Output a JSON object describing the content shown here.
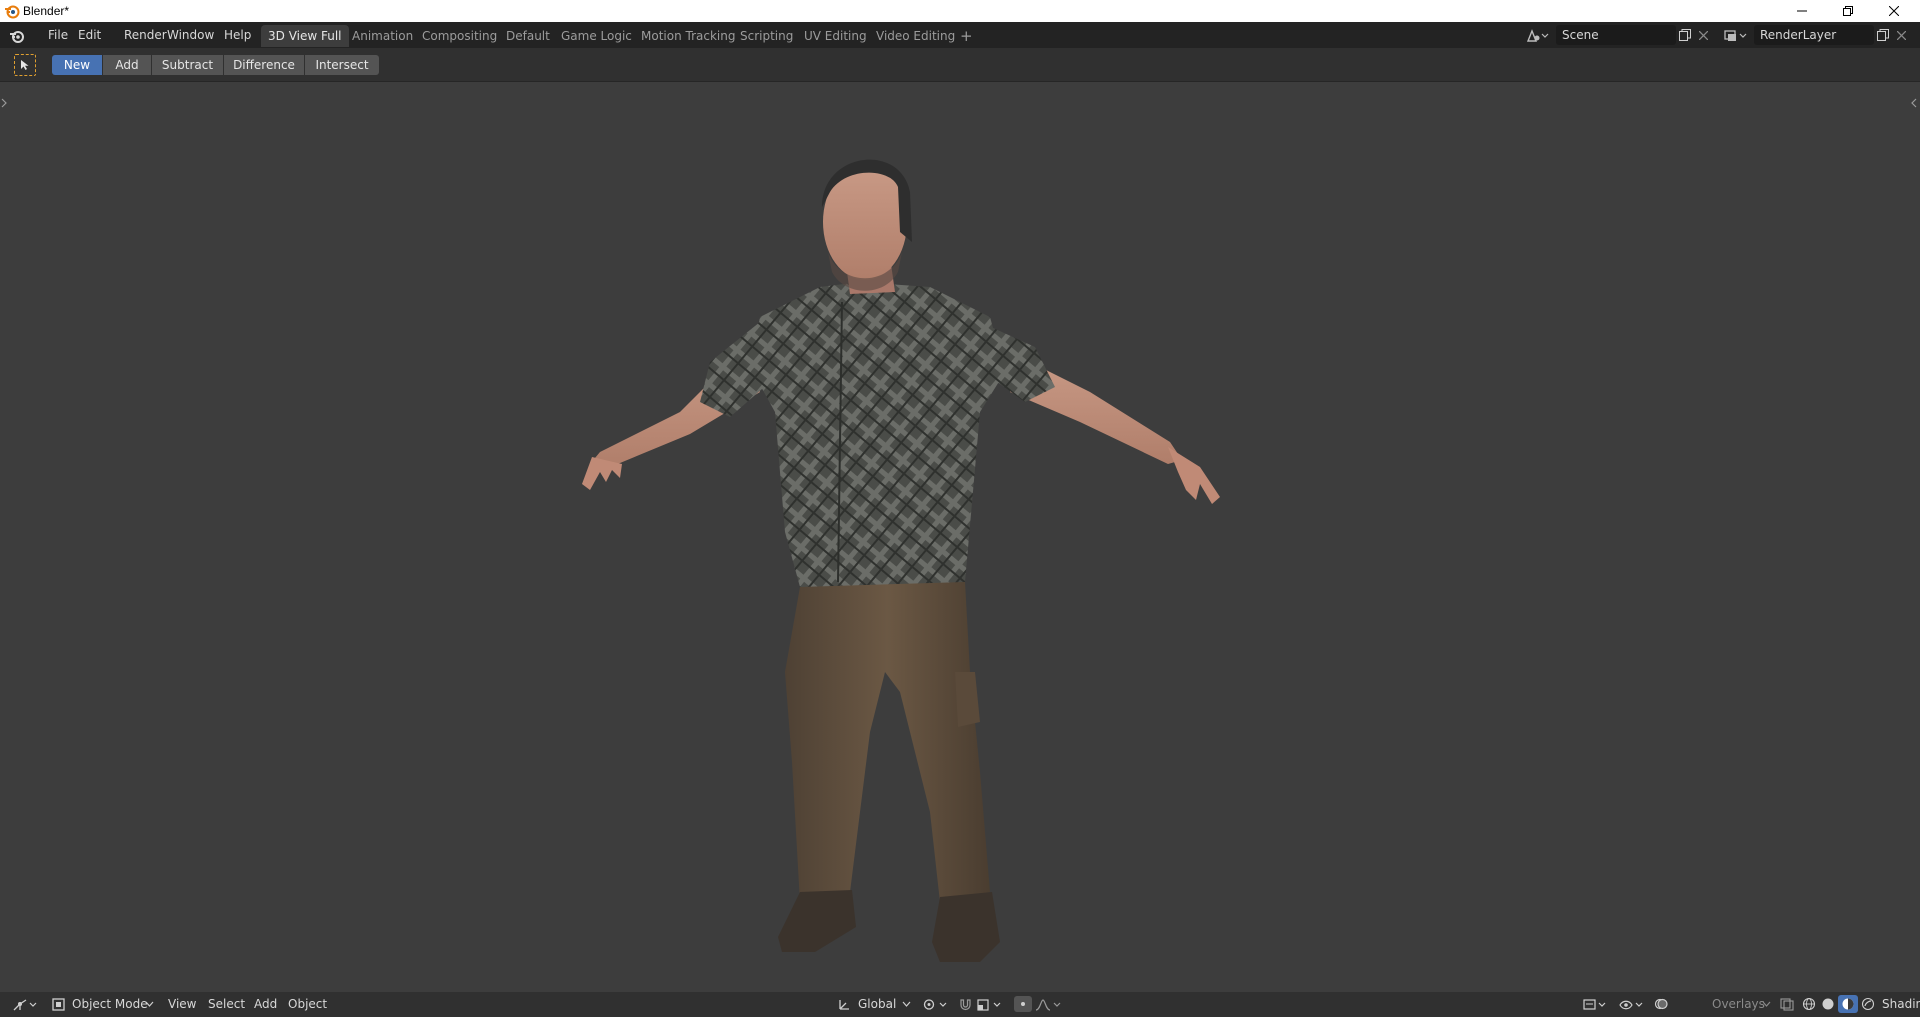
{
  "window": {
    "title": "Blender*",
    "minimize_icon": "minimize-icon",
    "restore_icon": "restore-icon",
    "close_icon": "close-icon"
  },
  "topbar": {
    "menus": [
      "File",
      "Edit",
      "Render",
      "Window",
      "Help"
    ],
    "workspaces": [
      {
        "label": "3D View Full",
        "active": true
      },
      {
        "label": "Animation",
        "active": false
      },
      {
        "label": "Compositing",
        "active": false
      },
      {
        "label": "Default",
        "active": false
      },
      {
        "label": "Game Logic",
        "active": false
      },
      {
        "label": "Motion Tracking",
        "active": false
      },
      {
        "label": "Scripting",
        "active": false
      },
      {
        "label": "UV Editing",
        "active": false
      },
      {
        "label": "Video Editing",
        "active": false
      }
    ],
    "add_workspace": "+",
    "scene_value": "Scene",
    "render_layer_value": "RenderLayer"
  },
  "tool_header": {
    "modes": [
      {
        "label": "New",
        "active": true
      },
      {
        "label": "Add",
        "active": false
      },
      {
        "label": "Subtract",
        "active": false
      },
      {
        "label": "Difference",
        "active": false
      },
      {
        "label": "Intersect",
        "active": false
      }
    ]
  },
  "bottom_header": {
    "mode": "Object Mode",
    "menus": [
      "View",
      "Select",
      "Add",
      "Object"
    ],
    "orientation": "Global",
    "overlays": "Overlays",
    "shading": "Shading"
  },
  "colors": {
    "accent": "#4772b3",
    "viewport_bg": "#3d3d3d",
    "header_bg": "#232323"
  }
}
